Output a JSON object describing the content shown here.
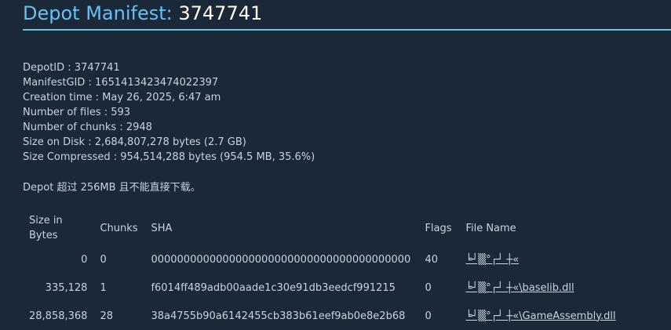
{
  "header": {
    "title_label": "Depot Manifest:",
    "title_id": "3747741"
  },
  "info": [
    "DepotID : 3747741",
    "ManifestGID : 1651413423474022397",
    "Creation time : May 26, 2025, 6:47 am",
    "Number of files : 593",
    "Number of chunks : 2948",
    "Size on Disk : 2,684,807,278 bytes (2.7 GB)",
    "Size Compressed : 954,514,288 bytes (954.5 MB, 35.6%)"
  ],
  "notice": "Depot 超过 256MB 且不能直接下载。",
  "table": {
    "headers": {
      "size": "Size in Bytes",
      "chunks": "Chunks",
      "sha": "SHA",
      "flags": "Flags",
      "name": "File Name"
    },
    "rows": [
      {
        "size": "0",
        "chunks": "0",
        "sha": "0000000000000000000000000000000000000000",
        "flags": "40",
        "name": "╘┘▒°┌┘ ┼«"
      },
      {
        "size": "335,128",
        "chunks": "1",
        "sha": "f6014ff489adb00aade1c30e91db3eedcf991215",
        "flags": "0",
        "name": "╘┘▒°┌┘ ┼«\\baselib.dll"
      },
      {
        "size": "28,858,368",
        "chunks": "28",
        "sha": "38a4755b90a6142455cb383b61eef9ab0e8e2b68",
        "flags": "0",
        "name": "╘┘▒°┌┘ ┼«\\GameAssembly.dll"
      }
    ]
  }
}
